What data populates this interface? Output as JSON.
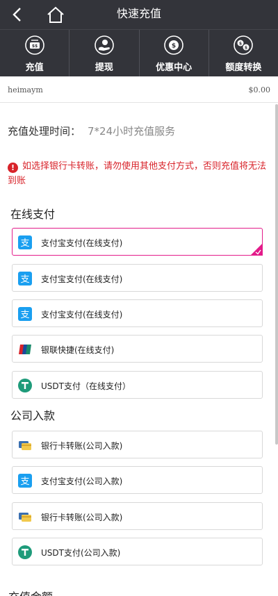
{
  "header": {
    "title": "快速充值"
  },
  "menu": [
    {
      "label": "充值",
      "icon": "deposit-icon"
    },
    {
      "label": "提现",
      "icon": "withdraw-icon"
    },
    {
      "label": "优惠中心",
      "icon": "promo-icon"
    },
    {
      "label": "额度转换",
      "icon": "transfer-icon"
    }
  ],
  "account": {
    "username": "heimaym",
    "balance": "$0.00"
  },
  "processing": {
    "label": "充值处理时间：",
    "value": "7*24小时充值服务"
  },
  "warning": "如选择银行卡转账，请勿使用其他支付方式，否则充值将无法到账",
  "online": {
    "title": "在线支付",
    "options": [
      {
        "label": "支付宝支付(在线支付)",
        "icon": "alipay-icon",
        "selected": true
      },
      {
        "label": "支付宝支付(在线支付)",
        "icon": "alipay-icon",
        "selected": false
      },
      {
        "label": "支付宝支付(在线支付)",
        "icon": "alipay-icon",
        "selected": false
      },
      {
        "label": "银联快捷(在线支付)",
        "icon": "unionpay-icon",
        "selected": false
      },
      {
        "label": "USDT支付（在线支付）",
        "icon": "usdt-icon",
        "selected": false
      }
    ]
  },
  "company": {
    "title": "公司入款",
    "options": [
      {
        "label": "银行卡转账(公司入款)",
        "icon": "bank-card-icon"
      },
      {
        "label": "支付宝支付(公司入款)",
        "icon": "alipay-icon"
      },
      {
        "label": "银行卡转账(公司入款)",
        "icon": "bank-card-icon"
      },
      {
        "label": "USDT支付(公司入款)",
        "icon": "usdt-icon"
      }
    ]
  },
  "next_section_title": "充值金额",
  "colors": {
    "header_bg": "#33343a",
    "accent": "#e31b8a",
    "warning": "#d8232a",
    "alipay": "#1a9ff0",
    "usdt": "#1e9b7a"
  }
}
